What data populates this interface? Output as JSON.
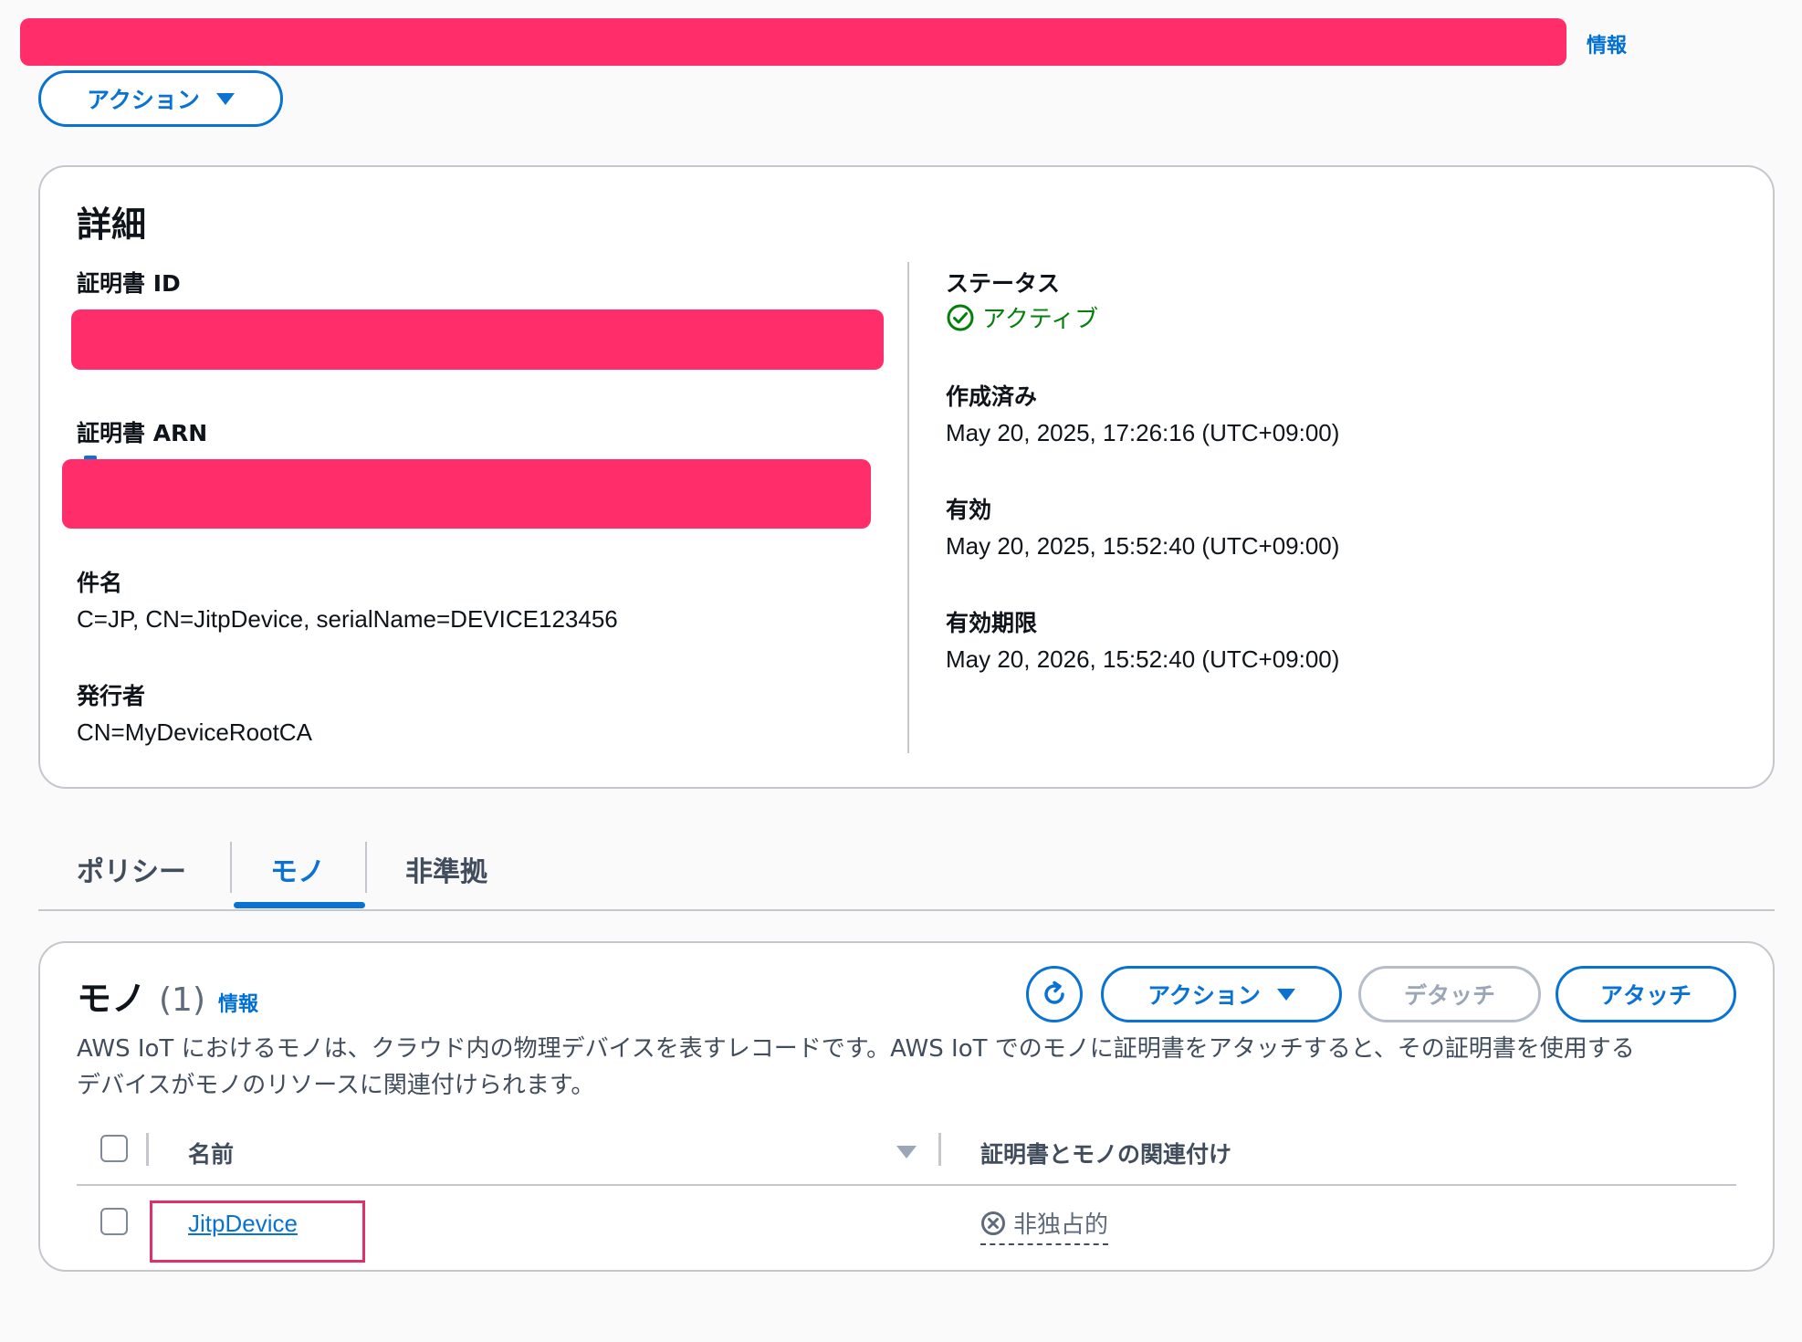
{
  "header": {
    "info_label": "情報",
    "actions_label": "アクション"
  },
  "details": {
    "title": "詳細",
    "cert_id_label": "証明書 ID",
    "cert_arn_label": "証明書 ARN",
    "subject_label": "件名",
    "subject_value": "C=JP, CN=JitpDevice, serialName=DEVICE123456",
    "issuer_label": "発行者",
    "issuer_value": "CN=MyDeviceRootCA",
    "status_label": "ステータス",
    "status_value": "アクティブ",
    "created_label": "作成済み",
    "created_value": "May 20, 2025, 17:26:16 (UTC+09:00)",
    "valid_label": "有効",
    "valid_value": "May 20, 2025, 15:52:40 (UTC+09:00)",
    "expiry_label": "有効期限",
    "expiry_value": "May 20, 2026, 15:52:40 (UTC+09:00)"
  },
  "tabs": [
    {
      "label": "ポリシー",
      "active": false
    },
    {
      "label": "モノ",
      "active": true
    },
    {
      "label": "非準拠",
      "active": false
    }
  ],
  "things": {
    "title": "モノ",
    "count": "(1)",
    "info_label": "情報",
    "actions_label": "アクション",
    "detach_label": "デタッチ",
    "attach_label": "アタッチ",
    "description_line1": "AWS IoT におけるモノは、クラウド内の物理デバイスを表すレコードです。AWS IoT でのモノに証明書をアタッチすると、その証明書を使用する",
    "description_line2": "デバイスがモノのリソースに関連付けられます。",
    "columns": {
      "name": "名前",
      "association": "証明書とモノの関連付け"
    },
    "rows": [
      {
        "name": "JitpDevice",
        "association": "非独占的"
      }
    ]
  },
  "colors": {
    "accent": "#0972d3",
    "success": "#037f0c",
    "redaction": "#ff2e6a",
    "highlight": "#e0306a"
  }
}
